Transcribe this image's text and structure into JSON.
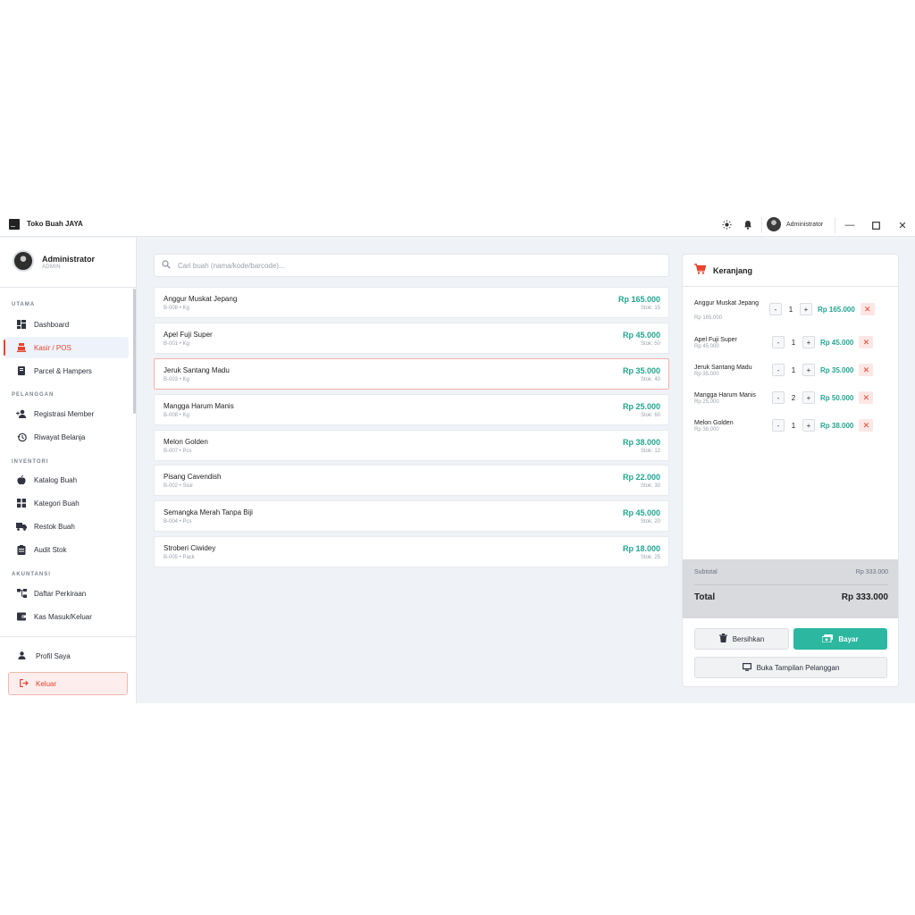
{
  "window": {
    "title": "Toko Buah JAYA",
    "user": "Administrator",
    "theme_icon": "sun-icon",
    "notify_icon": "bell-icon"
  },
  "sidebar": {
    "user_name": "Administrator",
    "user_role": "ADMIN",
    "sections": [
      "UTAMA",
      "PELANGGAN",
      "INVENTORI",
      "AKUNTANSI"
    ],
    "items": [
      {
        "label": "Dashboard",
        "icon": "dashboard-icon"
      },
      {
        "label": "Kasir / POS",
        "icon": "cash-register-icon",
        "active": true
      },
      {
        "label": "Parcel & Hampers",
        "icon": "book-icon"
      },
      {
        "label": "Registrasi Member",
        "icon": "add-user-icon"
      },
      {
        "label": "Riwayat Belanja",
        "icon": "history-icon"
      },
      {
        "label": "Katalog Buah",
        "icon": "apple-icon"
      },
      {
        "label": "Kategori Buah",
        "icon": "grid-icon"
      },
      {
        "label": "Restok Buah",
        "icon": "truck-icon"
      },
      {
        "label": "Audit Stok",
        "icon": "clipboard-icon"
      },
      {
        "label": "Daftar Perkiraan",
        "icon": "tree-icon"
      },
      {
        "label": "Kas Masuk/Keluar",
        "icon": "wallet-icon"
      }
    ],
    "profile_label": "Profil Saya",
    "logout_label": "Keluar"
  },
  "search": {
    "placeholder": "Cari buah (nama/kode/barcode)..."
  },
  "products": [
    {
      "name": "Anggur Muskat Jepang",
      "code": "B-008 • Kg",
      "price": "Rp 165.000",
      "stock": "Stok: 15"
    },
    {
      "name": "Apel Fuji Super",
      "code": "B-001 • Kg",
      "price": "Rp 45.000",
      "stock": "Stok: 50"
    },
    {
      "name": "Jeruk Santang Madu",
      "code": "B-003 • Kg",
      "price": "Rp 35.000",
      "stock": "Stok: 40"
    },
    {
      "name": "Mangga Harum Manis",
      "code": "B-008 • Kg",
      "price": "Rp 25.000",
      "stock": "Stok: 60"
    },
    {
      "name": "Melon Golden",
      "code": "B-007 • Pcs",
      "price": "Rp 38.000",
      "stock": "Stok: 12"
    },
    {
      "name": "Pisang Cavendish",
      "code": "B-002 • Sisir",
      "price": "Rp 22.000",
      "stock": "Stok: 30"
    },
    {
      "name": "Semangka Merah Tanpa Biji",
      "code": "B-004 • Pcs",
      "price": "Rp 45.000",
      "stock": "Stok: 20"
    },
    {
      "name": "Stroberi Ciwidey",
      "code": "B-005 • Pack",
      "price": "Rp 18.000",
      "stock": "Stok: 25"
    }
  ],
  "cart": {
    "title": "Keranjang",
    "items": [
      {
        "name": "Anggur Muskat Jepang",
        "unit_price": "Rp 165.000",
        "qty": "1",
        "total": "Rp 165.000"
      },
      {
        "name": "Apel Fuji Super",
        "unit_price": "Rp 45.000",
        "qty": "1",
        "total": "Rp 45.000"
      },
      {
        "name": "Jeruk Santang Madu",
        "unit_price": "Rp 35.000",
        "qty": "1",
        "total": "Rp 35.000"
      },
      {
        "name": "Mangga Harum Manis",
        "unit_price": "Rp 25.000",
        "qty": "2",
        "total": "Rp 50.000"
      },
      {
        "name": "Melon Golden",
        "unit_price": "Rp 38.000",
        "qty": "1",
        "total": "Rp 38.000"
      }
    ],
    "minus": "-",
    "plus": "+",
    "remove": "✕",
    "subtotal_label": "Subtotal",
    "subtotal_value": "Rp 333.000",
    "total_label": "Total",
    "total_value": "Rp 333.000",
    "clear_label": "Bersihkan",
    "pay_label": "Bayar",
    "display_label": "Buka Tampilan Pelanggan"
  },
  "colors": {
    "accent": "#e8432e",
    "price": "#22a58f",
    "pay_button": "#2bb7a0"
  }
}
